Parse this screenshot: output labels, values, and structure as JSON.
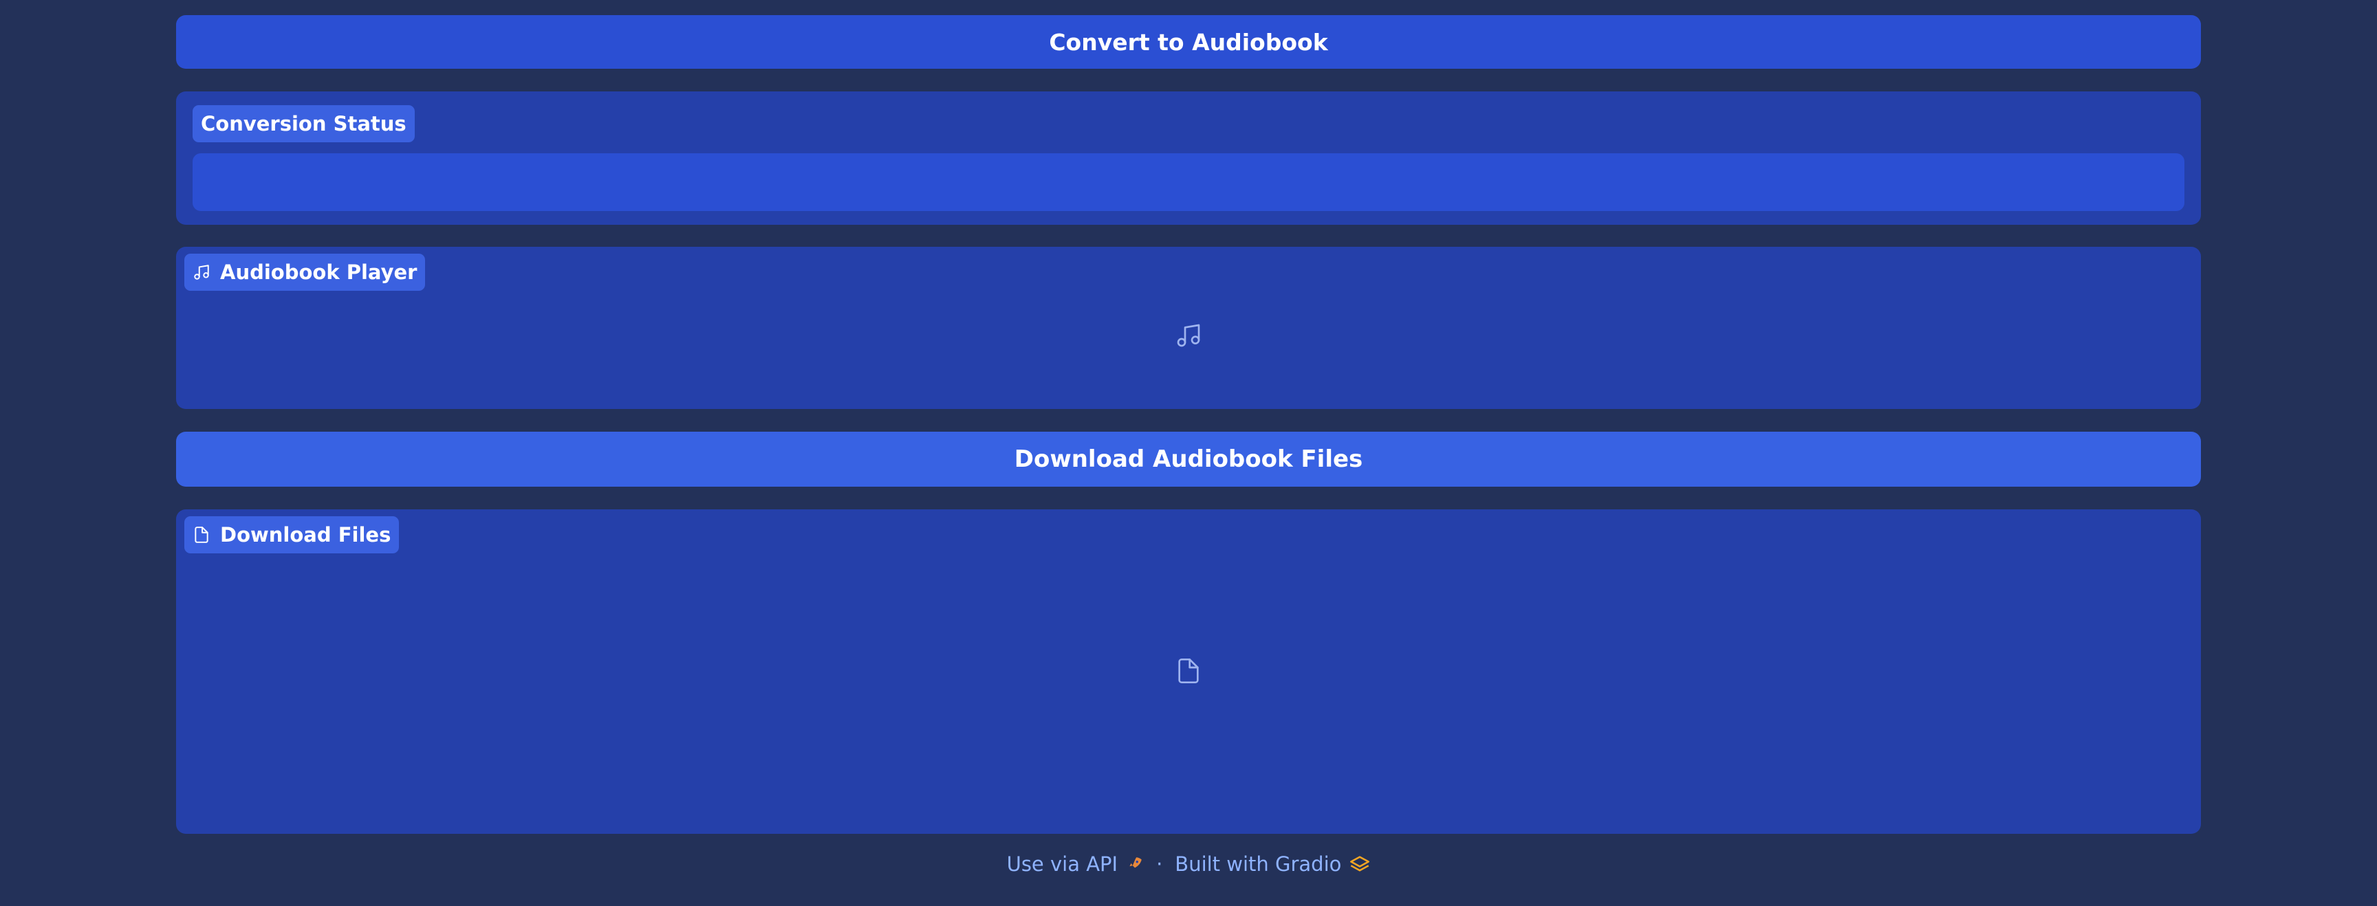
{
  "actions": {
    "convert_label": "Convert to Audiobook",
    "download_label": "Download Audiobook Files"
  },
  "status_panel": {
    "label": "Conversion Status",
    "value": ""
  },
  "player_panel": {
    "label": "Audiobook Player",
    "icon": "music-note-icon"
  },
  "files_panel": {
    "label": "Download Files",
    "icon": "file-icon"
  },
  "footer": {
    "api_label": "Use via API",
    "separator": "·",
    "built_label": "Built with Gradio"
  },
  "colors": {
    "background": "#233159",
    "panel": "#2540aa",
    "button_primary": "#2b4fd3",
    "button_secondary": "#3862e3",
    "badge": "#3b61e0",
    "footer_link": "#8fb3ff"
  }
}
